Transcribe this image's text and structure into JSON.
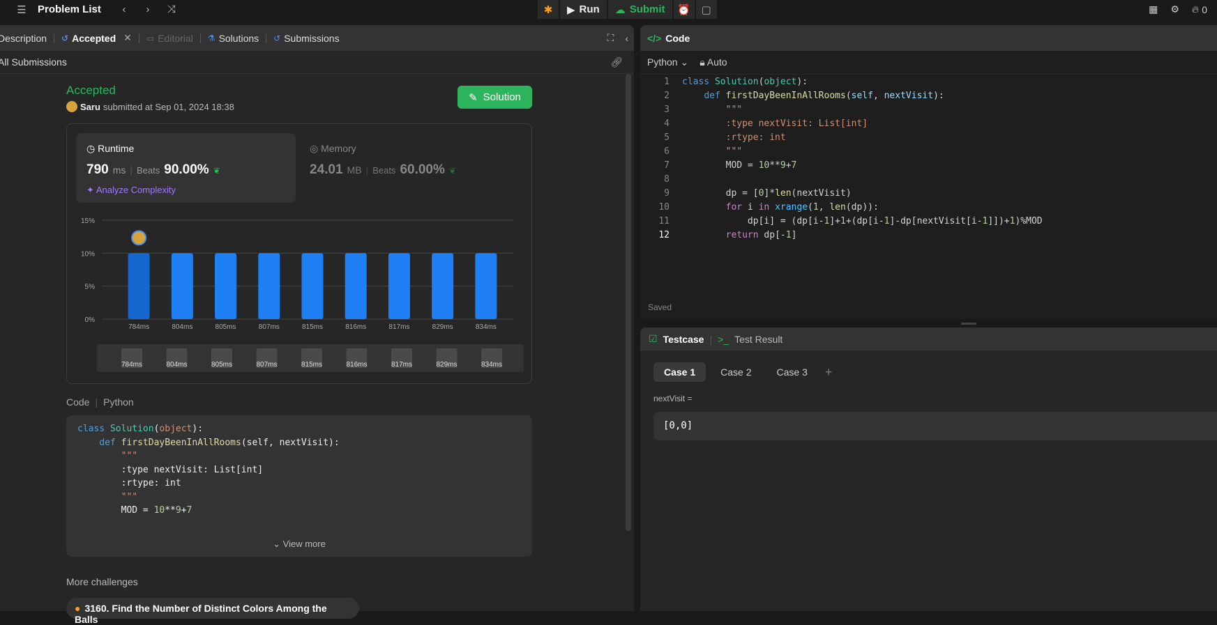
{
  "topbar": {
    "title": "Problem List",
    "run": "Run",
    "submit": "Submit",
    "streak": "0"
  },
  "left_tabs": {
    "description": "Description",
    "accepted": "Accepted",
    "editorial": "Editorial",
    "solutions": "Solutions",
    "submissions": "Submissions"
  },
  "all_submissions": "All Submissions",
  "result": {
    "status": "Accepted",
    "user": "Saru",
    "submitted_text": "submitted at Sep 01, 2024 18:38",
    "solution_button": "Solution"
  },
  "runtime": {
    "title": "Runtime",
    "value": "790",
    "unit": "ms",
    "beats_label": "Beats",
    "beats": "90.00%",
    "analyze": "Analyze Complexity"
  },
  "memory": {
    "title": "Memory",
    "value": "24.01",
    "unit": "MB",
    "beats_label": "Beats",
    "beats": "60.00%"
  },
  "chart_data": {
    "type": "bar",
    "categories": [
      "784ms",
      "804ms",
      "805ms",
      "807ms",
      "815ms",
      "816ms",
      "817ms",
      "829ms",
      "834ms"
    ],
    "values": [
      10,
      10,
      10,
      10,
      10,
      10,
      10,
      10,
      10
    ],
    "yticks": [
      "0%",
      "5%",
      "10%",
      "15%"
    ],
    "ylim": [
      0,
      15
    ],
    "highlight_index": 0,
    "bar_color": "#1f7ff5",
    "highlight_color": "#1668d1",
    "grid": true
  },
  "code_section": {
    "label": "Code",
    "language": "Python",
    "view_more": "View more"
  },
  "more_challenges": "More challenges",
  "challenge_item": "3160. Find the Number of Distinct Colors Among the Balls",
  "editor": {
    "title": "Code",
    "language": "Python",
    "mode": "Auto",
    "saved": "Saved"
  },
  "testcase": {
    "title": "Testcase",
    "result_tab": "Test Result",
    "cases": [
      "Case 1",
      "Case 2",
      "Case 3"
    ],
    "var_label": "nextVisit =",
    "var_value": "[0,0]"
  },
  "colors": {
    "accent_green": "#2db55d",
    "bar_blue": "#1f7ff5",
    "purple": "#a07aff"
  }
}
